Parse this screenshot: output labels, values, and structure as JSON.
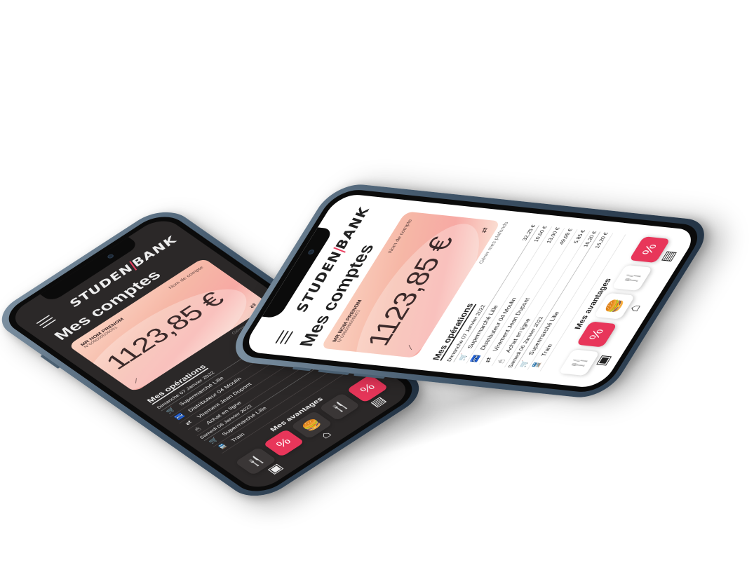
{
  "app": {
    "brand_left": "STUDEN",
    "brand_right": "BANK",
    "page_title": "Mes comptes",
    "card": {
      "holder": "MR NOM PRENOM",
      "iban": "N°000000000001",
      "account_name": "Nom de compte",
      "balance": "1123,85 €"
    },
    "manage_link": "Gérer mes plafonds",
    "operations_title": "Mes opérations",
    "days": [
      {
        "date": "Dimanche 07 Janvier 2022",
        "total": "32,25 €"
      },
      {
        "date": "Samedi 06 Janvier 2022",
        "total": "16,20 €"
      }
    ],
    "operations": [
      {
        "icon": "cart-icon",
        "glyph": "🛒",
        "label": "Supermarché Lille",
        "amount": "10,00 €"
      },
      {
        "icon": "atm-icon",
        "glyph": "🏧",
        "label": "Distributeur 04 Moulin",
        "amount": "13,00 €"
      },
      {
        "icon": "transfer-icon",
        "glyph": "⇄",
        "label": "Virement Jean Dupont",
        "amount": "49,99 €"
      },
      {
        "icon": "mouse-icon",
        "glyph": "🖱",
        "label": "Achat en ligne",
        "amount": "5,85 €"
      },
      {
        "icon": "cart-icon",
        "glyph": "🛒",
        "label": "Supermarché Lille",
        "amount": "16,20 €"
      },
      {
        "icon": "train-icon",
        "glyph": "🚆",
        "label": "Train",
        "amount": ""
      }
    ],
    "advantages_title": "Mes avantages",
    "advantages": [
      {
        "name": "restaurant-offer",
        "glyph": "🍴",
        "style": "white"
      },
      {
        "name": "shopping-offer",
        "glyph": "%",
        "style": "red"
      },
      {
        "name": "fastfood-offer",
        "glyph": "🍔",
        "style": "white"
      },
      {
        "name": "restaurant-offer-2",
        "glyph": "🍴",
        "style": "white"
      },
      {
        "name": "shopping-offer-2",
        "glyph": "%",
        "style": "red"
      }
    ],
    "tabbar": [
      {
        "name": "tab-accounts",
        "glyph": "▣"
      },
      {
        "name": "tab-home",
        "glyph": "⌂"
      },
      {
        "name": "tab-cards",
        "glyph": "▤"
      }
    ]
  },
  "colors": {
    "accent": "#e8365a",
    "dark_bg": "#2b2828",
    "light_bg": "#ffffff",
    "frame": "#41566a"
  }
}
